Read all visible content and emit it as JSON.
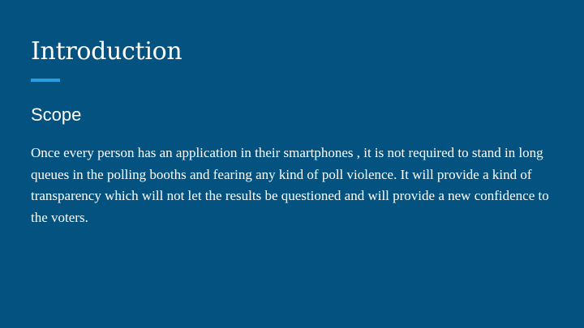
{
  "slide": {
    "title": "Introduction",
    "subtitle": "Scope",
    "body": "Once every person has an application in their smartphones , it is not required to stand in long queues in the polling booths and fearing any kind of poll violence. It will provide a kind of transparency which will not let the results be questioned and will provide a new confidence to the voters.",
    "colors": {
      "background": "#03527f",
      "accent": "#2b9de3",
      "text": "#ffffff"
    }
  }
}
